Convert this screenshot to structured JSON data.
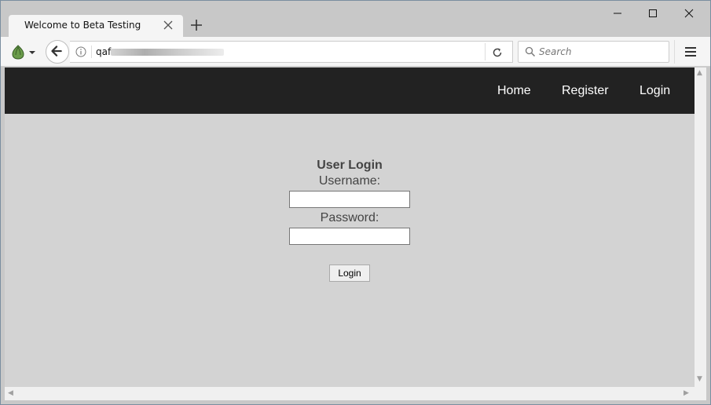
{
  "browser": {
    "tab_title": "Welcome to Beta Testing",
    "url_prefix": "qaf",
    "search_placeholder": "Search"
  },
  "site_nav": {
    "items": [
      {
        "label": "Home"
      },
      {
        "label": "Register"
      },
      {
        "label": "Login"
      }
    ]
  },
  "login_form": {
    "heading": "User Login",
    "username_label": "Username:",
    "username_value": "",
    "password_label": "Password:",
    "password_value": "",
    "submit_label": "Login"
  },
  "colors": {
    "site_nav_bg": "#222222",
    "page_bg": "#d3d3d3",
    "chrome_bg": "#c8c8c8"
  }
}
